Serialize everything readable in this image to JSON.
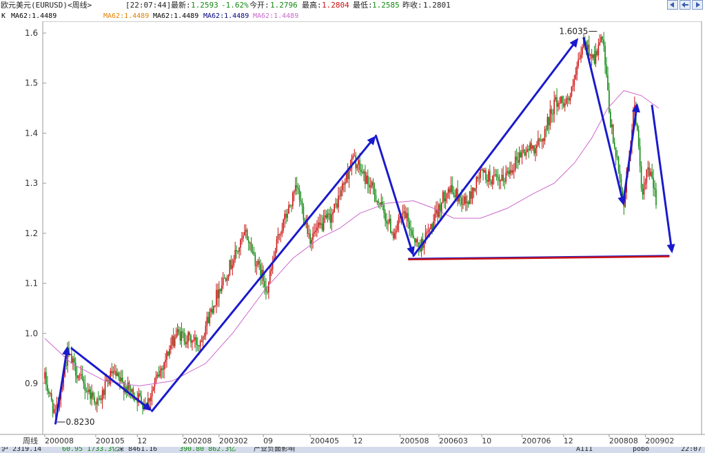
{
  "header": {
    "symbol": "欧元美元(EURUSD)<周线>",
    "time": "[22:07:44]",
    "latest_label": "最新:",
    "latest_value": "1.2593",
    "change": "-1.62%",
    "open_label": "今开:",
    "open_value": "1.2796",
    "high_label": "最高:",
    "high_value": "1.2804",
    "low_label": "最低:",
    "low_value": "1.2585",
    "prev_label": "昨收:",
    "prev_value": "1.2801"
  },
  "ma_legend": [
    {
      "text": "K",
      "color": "#000000"
    },
    {
      "text": "MA62:1.4489",
      "color": "#000000"
    },
    {
      "text": "MA62:1.4489",
      "color": "#e08000"
    },
    {
      "text": "MA62:1.4489",
      "color": "#000000"
    },
    {
      "text": "MA62:1.4489",
      "color": "#000080"
    },
    {
      "text": "MA62:1.4489",
      "color": "#cc66cc"
    }
  ],
  "chart_data": {
    "type": "candlestick",
    "y_ticks": [
      "1.6",
      "1.5",
      "1.4",
      "1.3",
      "1.2",
      "1.1",
      "1.0",
      "0.9"
    ],
    "y_tick_values": [
      1.6,
      1.5,
      1.4,
      1.3,
      1.2,
      1.1,
      1.0,
      0.9
    ],
    "ylim": [
      0.82,
      1.65
    ],
    "x_axis_label": "周线",
    "x_ticks": [
      {
        "label": "200008",
        "week": 0
      },
      {
        "label": "200105",
        "week": 38
      },
      {
        "label": "12",
        "week": 69
      },
      {
        "label": "200208",
        "week": 103
      },
      {
        "label": "200302",
        "week": 130
      },
      {
        "label": "09",
        "week": 163
      },
      {
        "label": "200405",
        "week": 198
      },
      {
        "label": "12",
        "week": 230
      },
      {
        "label": "200508",
        "week": 265
      },
      {
        "label": "200603",
        "week": 294
      },
      {
        "label": "10",
        "week": 326
      },
      {
        "label": "200706",
        "week": 356
      },
      {
        "label": "12",
        "week": 387
      },
      {
        "label": "200808",
        "week": 421
      },
      {
        "label": "200902",
        "week": 448
      }
    ],
    "total_weeks": 470,
    "anchors": [
      [
        0,
        0.91
      ],
      [
        8,
        0.835
      ],
      [
        17,
        0.96
      ],
      [
        28,
        0.9
      ],
      [
        40,
        0.86
      ],
      [
        50,
        0.92
      ],
      [
        65,
        0.88
      ],
      [
        76,
        0.86
      ],
      [
        90,
        0.95
      ],
      [
        98,
        1.0
      ],
      [
        115,
        0.98
      ],
      [
        130,
        1.09
      ],
      [
        150,
        1.2
      ],
      [
        158,
        1.14
      ],
      [
        166,
        1.09
      ],
      [
        175,
        1.2
      ],
      [
        188,
        1.29
      ],
      [
        198,
        1.19
      ],
      [
        215,
        1.24
      ],
      [
        230,
        1.35
      ],
      [
        246,
        1.28
      ],
      [
        260,
        1.2
      ],
      [
        268,
        1.24
      ],
      [
        279,
        1.17
      ],
      [
        290,
        1.22
      ],
      [
        300,
        1.29
      ],
      [
        315,
        1.26
      ],
      [
        325,
        1.32
      ],
      [
        340,
        1.3
      ],
      [
        355,
        1.36
      ],
      [
        370,
        1.38
      ],
      [
        380,
        1.46
      ],
      [
        392,
        1.47
      ],
      [
        402,
        1.58
      ],
      [
        410,
        1.55
      ],
      [
        416,
        1.59
      ],
      [
        422,
        1.42
      ],
      [
        432,
        1.26
      ],
      [
        440,
        1.46
      ],
      [
        446,
        1.27
      ],
      [
        450,
        1.33
      ],
      [
        456,
        1.27
      ]
    ],
    "ma62": {
      "name": "MA62",
      "color": "#cc66cc",
      "points": [
        [
          0,
          0.99
        ],
        [
          20,
          0.94
        ],
        [
          45,
          0.905
        ],
        [
          70,
          0.895
        ],
        [
          95,
          0.905
        ],
        [
          120,
          0.94
        ],
        [
          140,
          1.0
        ],
        [
          165,
          1.09
        ],
        [
          185,
          1.15
        ],
        [
          205,
          1.19
        ],
        [
          220,
          1.21
        ],
        [
          235,
          1.24
        ],
        [
          255,
          1.26
        ],
        [
          275,
          1.265
        ],
        [
          290,
          1.25
        ],
        [
          305,
          1.23
        ],
        [
          325,
          1.23
        ],
        [
          345,
          1.25
        ],
        [
          365,
          1.28
        ],
        [
          380,
          1.3
        ],
        [
          395,
          1.34
        ],
        [
          408,
          1.39
        ],
        [
          420,
          1.45
        ],
        [
          432,
          1.485
        ],
        [
          445,
          1.475
        ],
        [
          458,
          1.45
        ]
      ]
    },
    "annotations": [
      {
        "text": "0.8230",
        "week": 8,
        "value": 0.823,
        "side": "right"
      },
      {
        "text": "1.6035",
        "week": 413,
        "value": 1.6035,
        "side": "left"
      }
    ],
    "arrows": [
      {
        "from": [
          8,
          0.82
        ],
        "to": [
          17,
          0.975
        ],
        "color": "#1a1acc"
      },
      {
        "from": [
          20,
          0.97
        ],
        "to": [
          80,
          0.845
        ],
        "color": "#1a1acc"
      },
      {
        "from": [
          80,
          0.845
        ],
        "to": [
          247,
          1.395
        ],
        "color": "#1a1acc"
      },
      {
        "from": [
          247,
          1.395
        ],
        "to": [
          275,
          1.155
        ],
        "color": "#1a1acc"
      },
      {
        "from": [
          275,
          1.155
        ],
        "to": [
          398,
          1.59
        ],
        "color": "#1a1acc"
      },
      {
        "from": [
          402,
          1.59
        ],
        "to": [
          432,
          1.255
        ],
        "color": "#1a1acc"
      },
      {
        "from": [
          432,
          1.27
        ],
        "to": [
          442,
          1.46
        ],
        "color": "#1a1acc"
      },
      {
        "from": [
          453,
          1.455
        ],
        "to": [
          468,
          1.16
        ],
        "color": "#1a1acc"
      }
    ],
    "support_line": {
      "from": [
        271,
        1.148
      ],
      "to": [
        466,
        1.154
      ],
      "color": "#cc1111"
    },
    "up_color": "#cc1111",
    "down_color": "#118811"
  },
  "statusbar": {
    "items": [
      "沪 2319.14",
      "60.95 1733.3亿",
      "深 8461.16",
      "390.80 862.3亿",
      "产业负面影响",
      "A111",
      "pobo",
      "22:07"
    ]
  }
}
